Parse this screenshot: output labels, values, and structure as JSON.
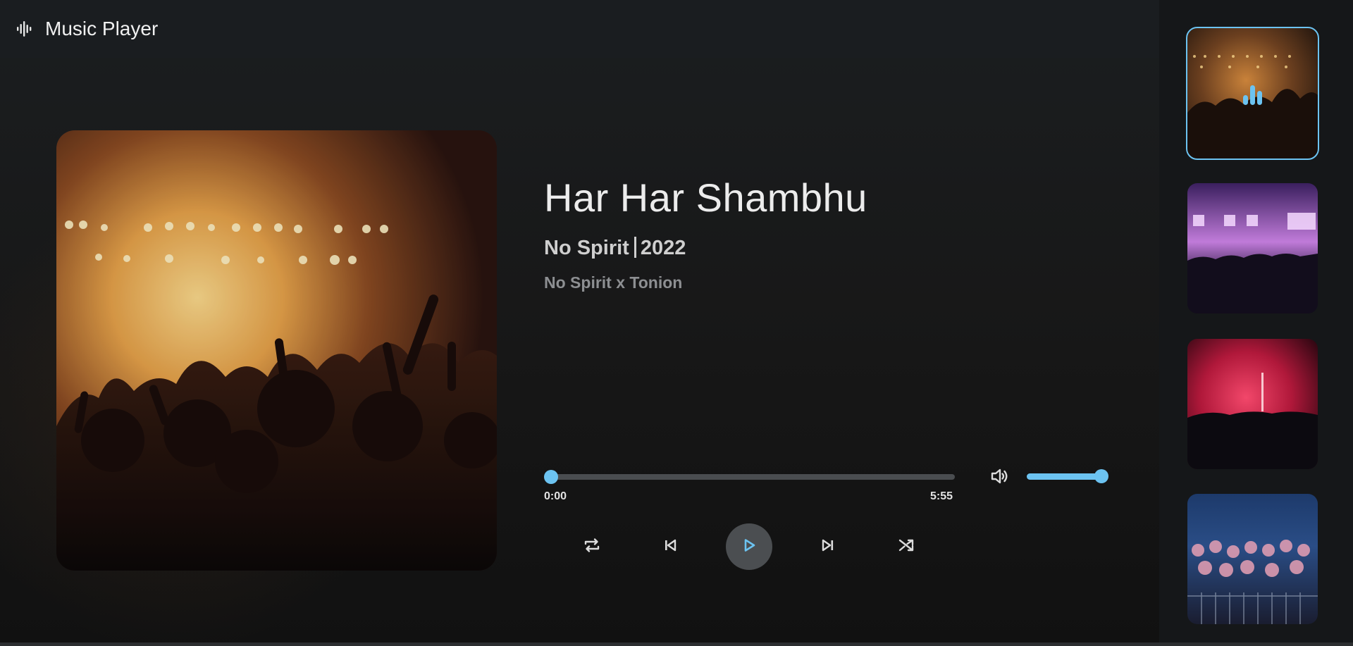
{
  "app": {
    "title": "Music Player"
  },
  "now_playing": {
    "title": "Har Har Shambhu",
    "artist": "No Spirit",
    "year": "2022",
    "artists_line": "No Spirit x Tonion",
    "current_time": "0:00",
    "total_time": "5:55",
    "progress_fraction": 0.0,
    "volume_fraction": 1.0
  },
  "controls": {
    "repeat": "repeat-icon",
    "previous": "skip-previous-icon",
    "play": "play-icon",
    "next": "skip-next-icon",
    "shuffle": "shuffle-icon",
    "volume": "volume-icon"
  },
  "playlist": [
    {
      "thumb": "concert-orange",
      "active": true
    },
    {
      "thumb": "concert-purple",
      "active": false
    },
    {
      "thumb": "concert-red",
      "active": false
    },
    {
      "thumb": "concert-blue",
      "active": false
    }
  ],
  "colors": {
    "accent": "#6cc3f1",
    "background": "#141618",
    "header": "#1a1d20"
  }
}
